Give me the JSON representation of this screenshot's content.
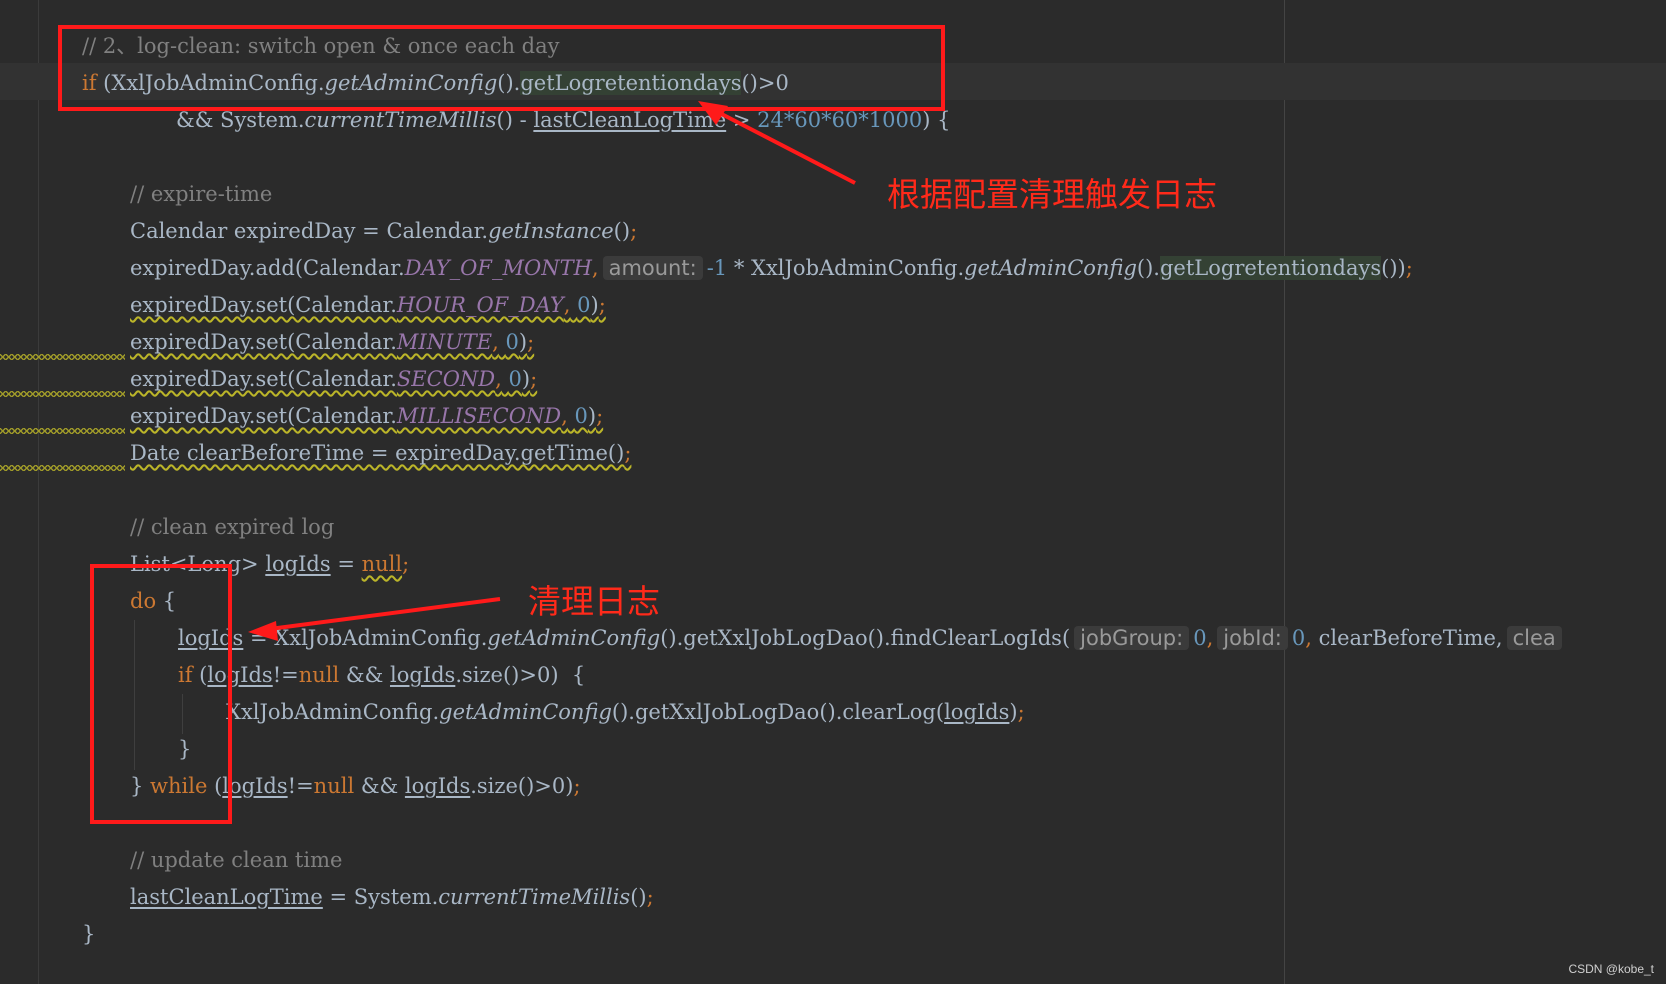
{
  "code": {
    "comment_switch": "// 2、log-clean: switch open & once each day",
    "if_kw": "if",
    "l2_open": " (XxlJobAdminConfig.",
    "getAdminConfig": "getAdminConfig",
    "paren_dot": "().",
    "getLogretentiondays": "getLogretentiondays",
    "l2_tail": "()>0",
    "l3_and": "&& System.",
    "currentTimeMillis": "currentTimeMillis",
    "l3_minus": "() - ",
    "lastCleanLogTime": "lastCleanLogTime",
    "l3_gt": " > ",
    "l3_num": "24*60*60*1000",
    "l3_tail": ") {",
    "comment_expire": "// expire-time",
    "l6_a": "Calendar expiredDay = Calendar.",
    "getInstance": "getInstance",
    "l6_b": "()",
    "semi": ";",
    "l7_a": "expiredDay.add(Calendar.",
    "DAY_OF_MONTH": "DAY_OF_MONTH",
    "comma": ",",
    "hint_amount": "amount:",
    "l7_b": "-1",
    "l7_c": " * XxlJobAdminConfig.",
    "l7_d": "())",
    "set_prefix": "expiredDay.set(Calendar.",
    "HOUR_OF_DAY": "HOUR_OF_DAY",
    "MINUTE": "MINUTE",
    "SECOND": "SECOND",
    "MILLISECOND": "MILLISECOND",
    "zero": "0",
    "close_paren": ")",
    "l12": "Date clearBeforeTime = expiredDay.getTime()",
    "comment_clean": "// clean expired log",
    "l15_a": "List<Long> ",
    "logIds": "logIds",
    "l15_b": " = ",
    "null": "null",
    "do_kw": "do",
    "brace_open": " {",
    "l17_a": " = XxlJobAdminConfig.",
    "l17_b": "().getXxlJobLogDao().findClearLogIds(",
    "hint_jobGroup": "jobGroup:",
    "hint_jobId": "jobId:",
    "l17_c": " clearBeforeTime,",
    "hint_clea": "clea",
    "l18_a": " (",
    "l18_b": "!=",
    "l18_c": " && ",
    "l18_d": ".size()>0)  {",
    "l19_a": "XxlJobAdminConfig.",
    "l19_b": "().getXxlJobLogDao().clearLog(",
    "brace_close": "}",
    "l21_a": "} ",
    "while_kw": "while",
    "l21_b": " (",
    "l21_c": ".size()>0)",
    "comment_update": "// update clean time",
    "l24_a": " = System.",
    "l24_b": "()",
    "l25": "}"
  },
  "annotations": {
    "label_top": "根据配置清理触发日志",
    "label_mid": "清理日志",
    "color": "#ff1a1a"
  },
  "watermark": "CSDN @kobe_t",
  "colors": {
    "background": "#2b2b2b",
    "keyword": "#cc7832",
    "comment": "#808080",
    "number": "#6897bb",
    "constant": "#9876aa",
    "text": "#a9b7c6"
  }
}
